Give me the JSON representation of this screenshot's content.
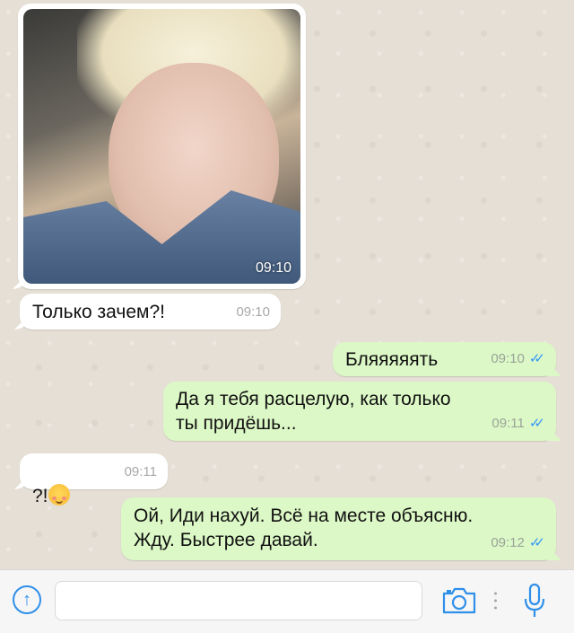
{
  "messages": [
    {
      "type": "image",
      "direction": "in",
      "time": "09:10"
    },
    {
      "type": "text",
      "direction": "in",
      "text": "Только зачем?!",
      "time": "09:10"
    },
    {
      "type": "text",
      "direction": "out",
      "text": "Бляяяяять",
      "time": "09:10",
      "status": "read"
    },
    {
      "type": "text",
      "direction": "out",
      "text": "Да я тебя расцелую, как только\nты придёшь...",
      "time": "09:11",
      "status": "read"
    },
    {
      "type": "text",
      "direction": "in",
      "text": "?!",
      "emoji": "smiling-blushing-face",
      "time": "09:11"
    },
    {
      "type": "text",
      "direction": "out",
      "text": "Ой, Иди нахуй. Всё на месте объясню.\nЖду. Быстрее давай.",
      "time": "09:12",
      "status": "read"
    }
  ],
  "input": {
    "placeholder": "",
    "value": ""
  },
  "colors": {
    "accent": "#2f8fe9",
    "outgoing_bubble": "#dcf8c6",
    "incoming_bubble": "#ffffff",
    "read_ticks": "#3497f9"
  },
  "icons": {
    "left": "upload-arrow-icon",
    "camera": "camera-icon",
    "mic": "microphone-icon",
    "ticks": "double-check-icon"
  }
}
